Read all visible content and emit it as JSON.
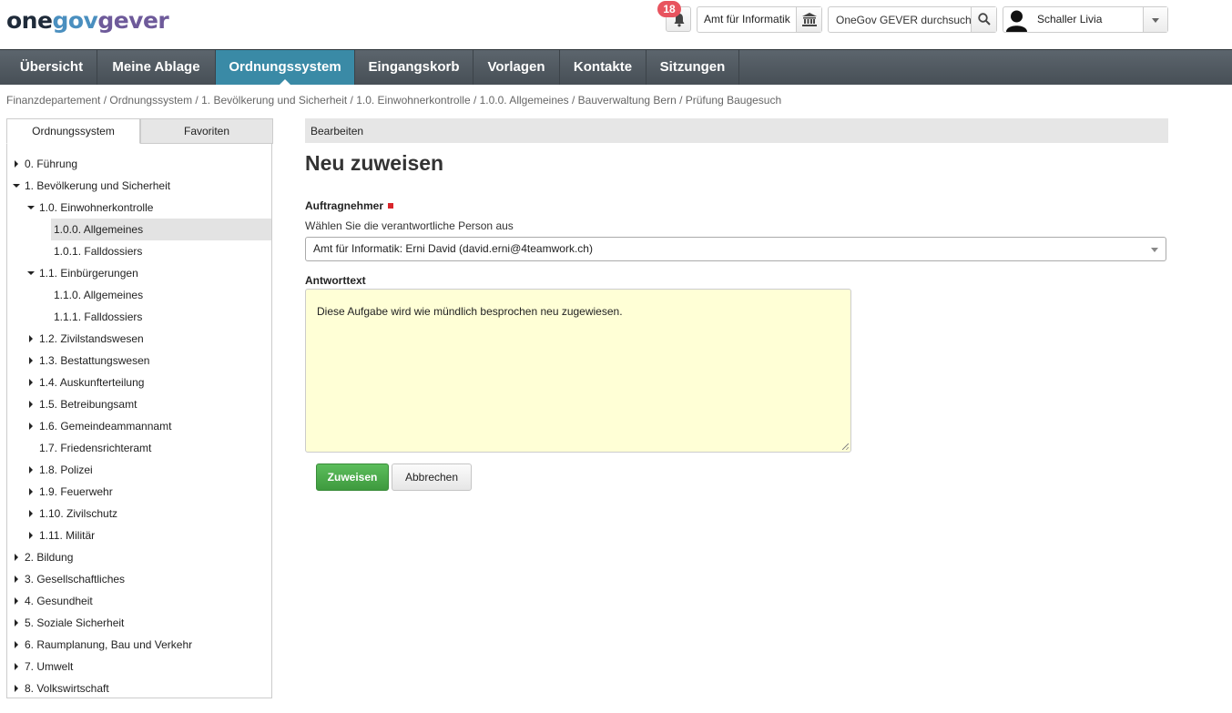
{
  "header": {
    "logo": {
      "part1": "one",
      "part2": "gov",
      "part3": "gever"
    },
    "notifications": {
      "count": "18"
    },
    "org_unit": {
      "label": "Amt für Informatik"
    },
    "search": {
      "placeholder": "OneGov GEVER durchsuchen"
    },
    "user": {
      "name": "Schaller Livia"
    }
  },
  "nav": {
    "tabs": [
      {
        "label": "Übersicht"
      },
      {
        "label": "Meine Ablage"
      },
      {
        "label": "Ordnungssystem"
      },
      {
        "label": "Eingangskorb"
      },
      {
        "label": "Vorlagen"
      },
      {
        "label": "Kontakte"
      },
      {
        "label": "Sitzungen"
      }
    ],
    "active": "Ordnungssystem"
  },
  "breadcrumb": "Finanzdepartement / Ordnungssystem / 1. Bevölkerung und Sicherheit / 1.0. Einwohnerkontrolle / 1.0.0. Allgemeines / Bauverwaltung Bern / Prüfung Baugesuch",
  "sidebar": {
    "tabs": [
      {
        "label": "Ordnungssystem"
      },
      {
        "label": "Favoriten"
      }
    ],
    "tree": [
      {
        "label": "0. Führung"
      },
      {
        "label": "1. Bevölkerung und Sicherheit"
      },
      {
        "label": "1.0. Einwohnerkontrolle"
      },
      {
        "label": "1.0.0. Allgemeines"
      },
      {
        "label": "1.0.1. Falldossiers"
      },
      {
        "label": "1.1. Einbürgerungen"
      },
      {
        "label": "1.1.0. Allgemeines"
      },
      {
        "label": "1.1.1. Falldossiers"
      },
      {
        "label": "1.2. Zivilstandswesen"
      },
      {
        "label": "1.3. Bestattungswesen"
      },
      {
        "label": "1.4. Auskunfterteilung"
      },
      {
        "label": "1.5. Betreibungsamt"
      },
      {
        "label": "1.6. Gemeindeammannamt"
      },
      {
        "label": "1.7. Friedensrichteramt"
      },
      {
        "label": "1.8. Polizei"
      },
      {
        "label": "1.9. Feuerwehr"
      },
      {
        "label": "1.10. Zivilschutz"
      },
      {
        "label": "1.11. Militär"
      },
      {
        "label": "2. Bildung"
      },
      {
        "label": "3. Gesellschaftliches"
      },
      {
        "label": "4. Gesundheit"
      },
      {
        "label": "5. Soziale Sicherheit"
      },
      {
        "label": "6. Raumplanung, Bau und Verkehr"
      },
      {
        "label": "7. Umwelt"
      },
      {
        "label": "8. Volkswirtschaft"
      }
    ]
  },
  "main": {
    "header": "Bearbeiten",
    "title": "Neu zuweisen",
    "assignee": {
      "label": "Auftragnehmer",
      "help": "Wählen Sie die verantwortliche Person aus",
      "value": "Amt für Informatik: Erni David (david.erni@4teamwork.ch)"
    },
    "response": {
      "label": "Antworttext",
      "value": "Diese Aufgabe wird wie mündlich besprochen neu zugewiesen."
    },
    "buttons": {
      "submit": "Zuweisen",
      "cancel": "Abbrechen"
    }
  }
}
